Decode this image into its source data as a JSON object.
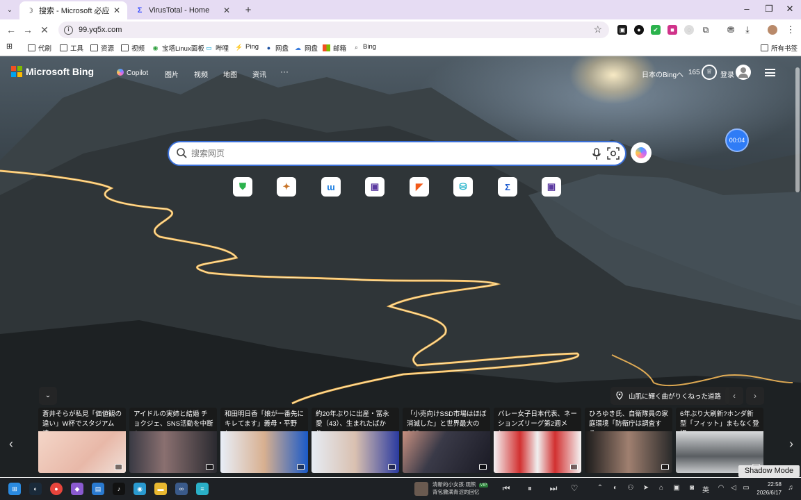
{
  "browser": {
    "tabs": [
      {
        "title": "搜索 - Microsoft 必应",
        "active": true
      },
      {
        "title": "VirusTotal - Home",
        "active": false
      }
    ],
    "new_tab": "+",
    "url": "99.yq5x.com",
    "bookmarks": [
      {
        "label": "代刷",
        "icon": "folder-icon"
      },
      {
        "label": "工具",
        "icon": "folder-icon"
      },
      {
        "label": "资源",
        "icon": "folder-icon"
      },
      {
        "label": "视频",
        "icon": "folder-icon"
      },
      {
        "label": "宝塔Linux面板",
        "icon": "bt-icon"
      },
      {
        "label": "哔哩",
        "icon": "bilibili-icon"
      },
      {
        "label": "Ping",
        "icon": "ping-icon"
      },
      {
        "label": "网盘",
        "icon": "disk-icon"
      },
      {
        "label": "网盘",
        "icon": "cloud-icon"
      },
      {
        "label": "邮箱",
        "icon": "mail-icon"
      },
      {
        "label": "Bing",
        "icon": "search-icon"
      }
    ],
    "all_bookmarks": "所有书签"
  },
  "bing": {
    "logo": "Microsoft Bing",
    "nav": [
      "Copilot",
      "图片",
      "视频",
      "地图",
      "资讯"
    ],
    "more": "···",
    "region_link": "日本のBingへ",
    "points": "165",
    "signin": "登录",
    "timer": "00:04",
    "search_placeholder": "搜索网页",
    "image_caption": "山肌に輝く曲がりくねった道路",
    "news": [
      {
        "title": "蒼井そらが私見「価値観の違い」W杯でスタジアム清…"
      },
      {
        "title": "アイドルの実姉と結婚 チョクジェ、SNS活動を中断へ…"
      },
      {
        "title": "和田明日香「娘が一番先にキレてます」義母・平野レ…"
      },
      {
        "title": "約20年ぶりに出産・冨永愛（43）、生まれたばかり…"
      },
      {
        "title": "「小売向けSSD市場はほぼ消滅した」と世界最大のSSD…"
      },
      {
        "title": "バレー女子日本代表、ネーションズリーグ第2週メン…"
      },
      {
        "title": "ひろゆき氏、自衛隊員の家庭環境「防衛庁は調査する…"
      },
      {
        "title": "6年ぶり大刷新?ホンダ新型「フィット」まもなく登場…"
      }
    ]
  },
  "taskbar": {
    "media_title": "清新的小女孩·观熊",
    "media_vip": "VIP",
    "media_sub": "背包撒满青涩的回忆",
    "ime": "英",
    "time": "22:58",
    "date": "2026/6/17"
  },
  "overlay": {
    "shadow_mode": "Shadow Mode"
  }
}
